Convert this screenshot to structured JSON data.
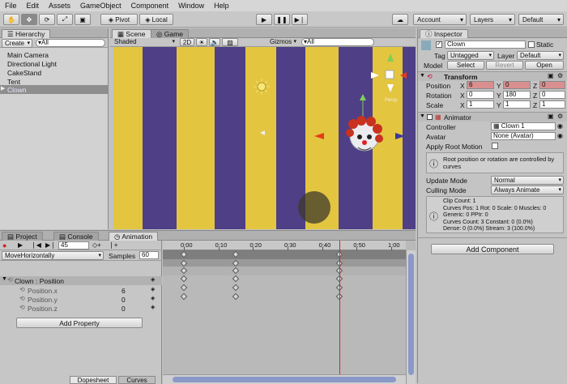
{
  "menu": [
    "File",
    "Edit",
    "Assets",
    "GameObject",
    "Component",
    "Window",
    "Help"
  ],
  "toolbar": {
    "pivot": "Pivot",
    "local": "Local",
    "account": "Account",
    "layers": "Layers",
    "layout": "Default"
  },
  "hierarchy": {
    "tab": "Hierarchy",
    "create": "Create",
    "search": "▾All",
    "items": [
      "Main Camera",
      "Directional Light",
      "CakeStand",
      "Tent",
      "Clown"
    ]
  },
  "scene": {
    "tab_scene": "Scene",
    "tab_game": "Game",
    "shaded": "Shaded",
    "mode2d": "2D",
    "gizmos": "Gizmos",
    "search": "▾All",
    "axis_label": "Persp"
  },
  "inspector": {
    "tab": "Inspector",
    "name": "Clown",
    "static": "Static",
    "tag_label": "Tag",
    "tag": "Untagged",
    "layer_label": "Layer",
    "layer": "Default",
    "model_label": "Model",
    "select": "Select",
    "revert": "Revert",
    "open": "Open",
    "transform": {
      "title": "Transform",
      "position_label": "Position",
      "rotation_label": "Rotation",
      "scale_label": "Scale",
      "px": "6",
      "py": "0",
      "pz": "0",
      "rx": "0",
      "ry": "180",
      "rz": "0",
      "sx": "1",
      "sy": "1",
      "sz": "1",
      "xl": "X",
      "yl": "Y",
      "zl": "Z"
    },
    "animator": {
      "title": "Animator",
      "controller_label": "Controller",
      "controller": "Clown 1",
      "avatar_label": "Avatar",
      "avatar": "None (Avatar)",
      "apply_root": "Apply Root Motion",
      "info": "Root position or rotation are controlled by curves",
      "update_label": "Update Mode",
      "update": "Normal",
      "culling_label": "Culling Mode",
      "culling": "Always Animate",
      "stats": [
        "Clip Count: 1",
        "Curves Pos: 1 Rot: 0 Scale: 0 Muscles: 0",
        "Generic: 0 PPtr: 0",
        "Curves Count: 3 Constant: 0 (0.0%)",
        "Dense: 0 (0.0%) Stream: 3 (100.0%)"
      ]
    },
    "add_component": "Add Component"
  },
  "bottom": {
    "tab_project": "Project",
    "tab_console": "Console",
    "tab_animation": "Animation",
    "frame": "45",
    "clip": "MoveHorizontally",
    "samples_label": "Samples",
    "samples": "60",
    "props": [
      {
        "name": "Clown : Position",
        "value": ""
      },
      {
        "name": "Position.x",
        "value": "6"
      },
      {
        "name": "Position.y",
        "value": "0"
      },
      {
        "name": "Position.z",
        "value": "0"
      }
    ],
    "add_property": "Add Property",
    "dopesheet": "Dopesheet",
    "curves": "Curves",
    "ticks": [
      "0:00",
      "0:10",
      "0:20",
      "0:30",
      "0:40",
      "0:50",
      "1:00"
    ],
    "playhead": 0.75,
    "keyframes": [
      0,
      0.25,
      0.75
    ]
  },
  "colors": {
    "stripe_yellow": "#e3c53f",
    "stripe_purple": "#4e3f86",
    "playhead": "#e02020"
  }
}
